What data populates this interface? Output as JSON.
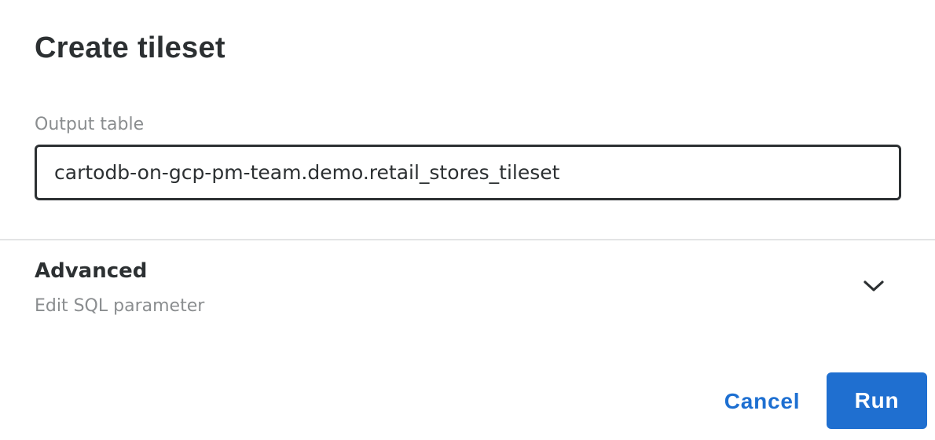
{
  "dialog": {
    "title": "Create tileset"
  },
  "output_table": {
    "label": "Output table",
    "value": "cartodb-on-gcp-pm-team.demo.retail_stores_tileset"
  },
  "advanced": {
    "title": "Advanced",
    "subtitle": "Edit SQL parameter",
    "icon": "chevron-down-icon",
    "expanded": false
  },
  "actions": {
    "cancel_label": "Cancel",
    "run_label": "Run"
  },
  "colors": {
    "text_primary": "#2c3032",
    "text_secondary": "#8a8d8f",
    "accent": "#1f6fd0",
    "divider": "#e3e4e5"
  }
}
